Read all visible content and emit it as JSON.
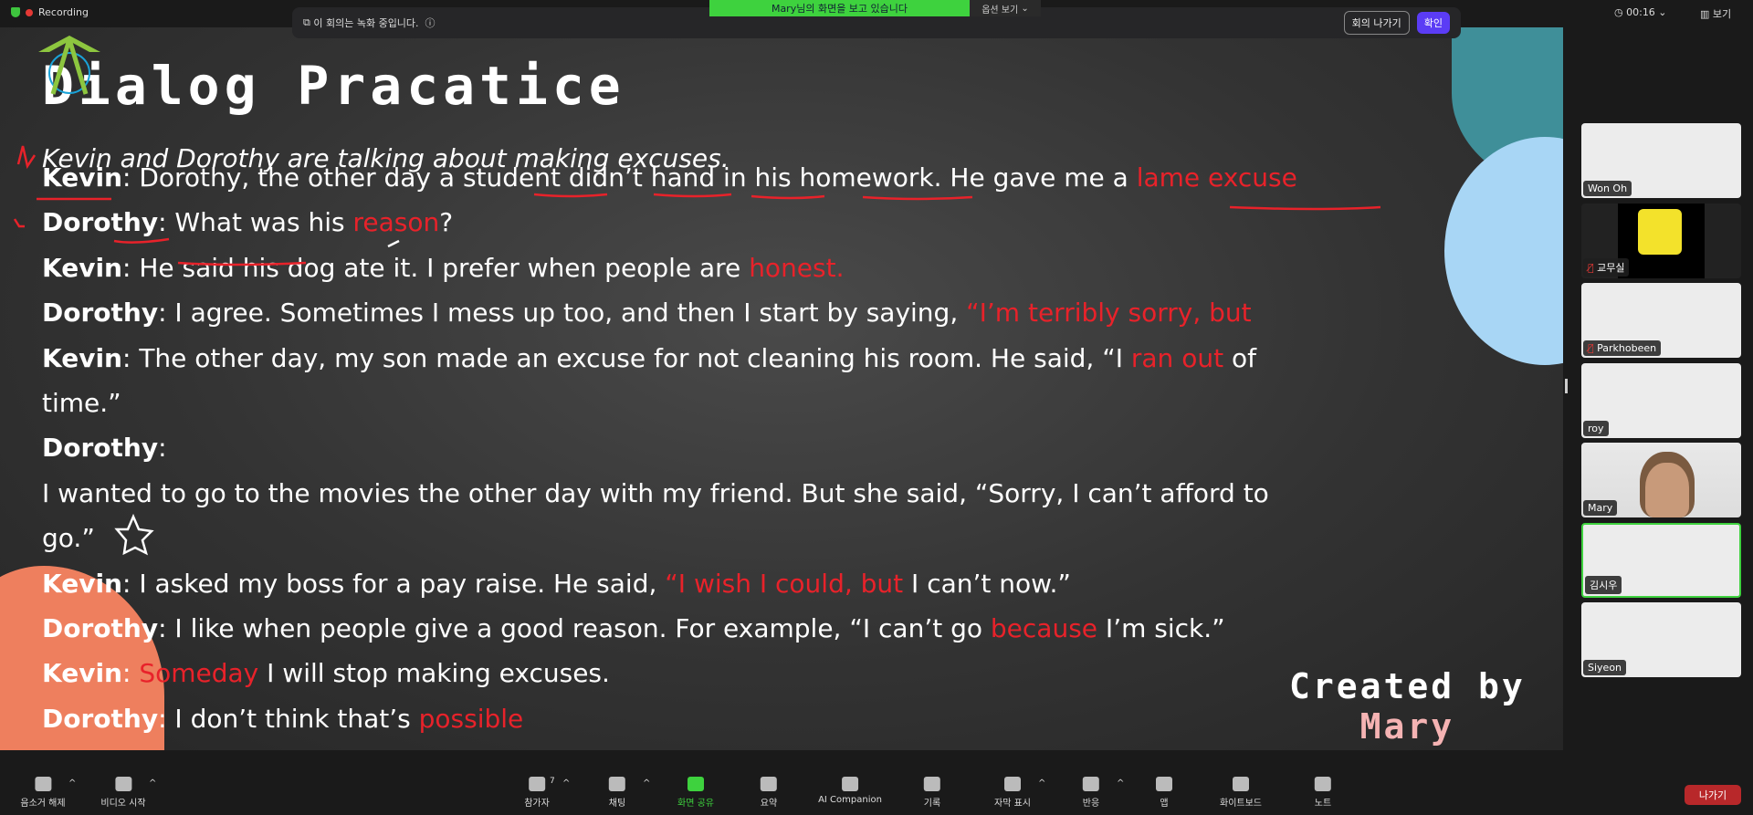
{
  "topbar": {
    "recording": "Recording",
    "notice": "이 회의는 녹화 중입니다.",
    "leave_meeting": "회의 나가기",
    "confirm": "확인",
    "sharing_banner": "Mary님의 화면을 보고 있습니다",
    "view_options": "옵션 보기",
    "timer": "00:16",
    "view": "보기"
  },
  "slide": {
    "title": "Dialog Pracatice",
    "subtitle": "Kevin and Dorothy are talking about making excuses.",
    "lines": [
      [
        [
          "Kevin",
          "b"
        ],
        [
          ": Dorothy, the other day a student didn’t hand in his homework. He gave me a ",
          ""
        ],
        [
          "lame excuse",
          "r"
        ]
      ],
      [
        [
          "Dorothy",
          "b"
        ],
        [
          ": What was his ",
          ""
        ],
        [
          "reason",
          "r"
        ],
        [
          "?",
          ""
        ]
      ],
      [
        [
          "Kevin",
          "b"
        ],
        [
          ": He said his dog ate it. I prefer when people are ",
          ""
        ],
        [
          "honest.",
          "r"
        ]
      ],
      [
        [
          "Dorothy",
          "b"
        ],
        [
          ": I agree. Sometimes I mess up too, and then I start by saying, ",
          ""
        ],
        [
          "“I’m terribly sorry, but",
          "r"
        ]
      ],
      [
        [
          "Kevin",
          "b"
        ],
        [
          ": The other day, my son made an excuse for not cleaning his room. He said, “I ",
          ""
        ],
        [
          "ran out",
          "r"
        ],
        [
          " of",
          ""
        ]
      ],
      [
        [
          "time.”",
          ""
        ]
      ],
      [
        [
          "Dorothy",
          "b"
        ],
        [
          ":",
          ""
        ]
      ],
      [
        [
          "I wanted to go to the movies the other day with my friend. But she said, “Sorry, I can’t afford to",
          ""
        ]
      ],
      [
        [
          "go.”",
          ""
        ]
      ],
      [
        [
          "Kevin",
          "b"
        ],
        [
          ": I asked my boss for a pay raise. He said, ",
          ""
        ],
        [
          "“I wish I could, but",
          "r"
        ],
        [
          " I can’t now.”",
          ""
        ]
      ],
      [
        [
          "Dorothy",
          "b"
        ],
        [
          ": I like when people give a good reason. For example, “I can’t go ",
          ""
        ],
        [
          "because",
          "r"
        ],
        [
          " I’m sick.”",
          ""
        ]
      ],
      [
        [
          "Kevin",
          "b"
        ],
        [
          ": ",
          ""
        ],
        [
          "Someday",
          "r"
        ],
        [
          " I will stop making excuses.",
          ""
        ]
      ],
      [
        [
          "Dorothy",
          "b"
        ],
        [
          ": I don’t think that’s ",
          ""
        ],
        [
          "possible",
          "r"
        ]
      ]
    ],
    "credit_line1": "Created by",
    "credit_line2": "Mary"
  },
  "participants": [
    {
      "name": "Won Oh"
    },
    {
      "name": "교무실",
      "muted": true
    },
    {
      "name": "Parkhobeen",
      "muted": true
    },
    {
      "name": "roy"
    },
    {
      "name": "Mary"
    },
    {
      "name": "김시우",
      "speaking": true
    },
    {
      "name": "Siyeon"
    }
  ],
  "toolbar": {
    "items": [
      {
        "label": "음소거 해제",
        "icon": "mic-off-icon"
      },
      {
        "label": "비디오 시작",
        "icon": "video-off-icon"
      },
      {
        "label": "참가자",
        "icon": "participants-icon",
        "count": "7"
      },
      {
        "label": "채팅",
        "icon": "chat-icon"
      },
      {
        "label": "화면 공유",
        "icon": "share-screen-icon"
      },
      {
        "label": "요약",
        "icon": "summary-icon"
      },
      {
        "label": "AI Companion",
        "icon": "ai-companion-icon"
      },
      {
        "label": "기록",
        "icon": "record-icon"
      },
      {
        "label": "자막 표시",
        "icon": "captions-icon"
      },
      {
        "label": "반응",
        "icon": "reactions-icon"
      },
      {
        "label": "앱",
        "icon": "apps-icon"
      },
      {
        "label": "화이트보드",
        "icon": "whiteboard-icon"
      },
      {
        "label": "노트",
        "icon": "notes-icon"
      }
    ],
    "leave": "나가기"
  },
  "colors": {
    "accent": "#3ed23e",
    "highlight": "#e8222a",
    "leave": "#b8282a",
    "confirm": "#5b3cf5"
  }
}
